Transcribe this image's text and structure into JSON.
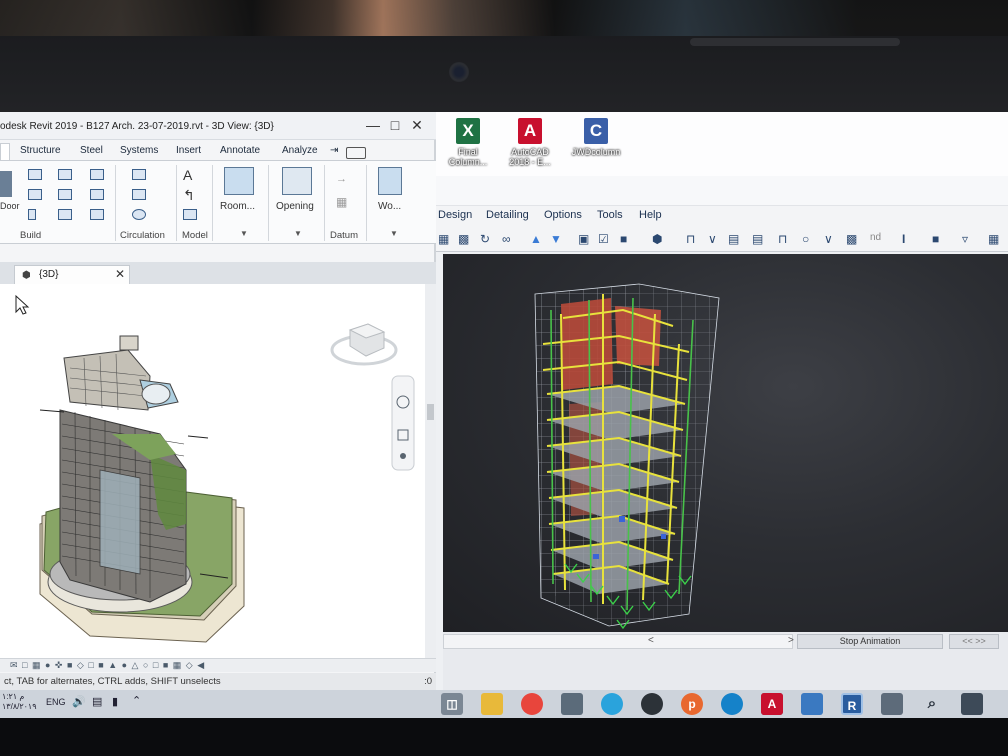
{
  "revit": {
    "title": "odesk Revit 2019 - B127 Arch. 23-07-2019.rvt - 3D View: {3D}",
    "window_controls": {
      "minimize": "—",
      "maximize": "□",
      "close": "✕"
    },
    "tabs": [
      "Structure",
      "Steel",
      "Systems",
      "Insert",
      "Annotate",
      "Analyze",
      "⇥"
    ],
    "ribbon": {
      "door_label": "Door",
      "groups": [
        "Build",
        "Circulation",
        "Model",
        "Datum"
      ],
      "big_buttons": [
        "Room...",
        "Opening",
        "Wo..."
      ]
    },
    "view_tab": {
      "label": "{3D}",
      "close": "✕"
    },
    "statusbar": {
      "hint": "ct, TAB for alternates, CTRL adds, SHIFT unselects",
      "right": ":0"
    }
  },
  "desktop_icons": [
    {
      "name": "excel-icon",
      "label": "Final Column...",
      "color": "#1f7244",
      "glyph": "X"
    },
    {
      "name": "autocad-icon",
      "label": "AutoCAD 2018 - E...",
      "color": "#c8102e",
      "glyph": "A"
    },
    {
      "name": "column-icon",
      "label": "JWDcolumn",
      "color": "#3a5fa8",
      "glyph": "C"
    }
  ],
  "etabs": {
    "menu": [
      "Design",
      "Detailing",
      "Options",
      "Tools",
      "Help"
    ],
    "toolbar_text": {
      "nd": "nd",
      "beam": "I"
    },
    "scroll": {
      "left": "<",
      "right": ">"
    },
    "stop_animation": "Stop Animation",
    "nav_arrows": "<< >>"
  },
  "taskbar": {
    "language": "ENG",
    "clock": [
      "م ١:٢١",
      "١٣/٨/٢٠١٩"
    ],
    "apps": [
      {
        "name": "task-view-icon",
        "color": "#7b8794",
        "glyph": "◫"
      },
      {
        "name": "file-explorer-icon",
        "color": "#e8b93a",
        "glyph": ""
      },
      {
        "name": "chrome-icon",
        "color": "#e8453c",
        "glyph": ""
      },
      {
        "name": "store-icon",
        "color": "#5b6b7a",
        "glyph": ""
      },
      {
        "name": "telegram-icon",
        "color": "#2aa3dc",
        "glyph": ""
      },
      {
        "name": "media-icon",
        "color": "#2c3238",
        "glyph": ""
      },
      {
        "name": "pdf-icon",
        "color": "#e8682f",
        "glyph": "p"
      },
      {
        "name": "edge-icon",
        "color": "#1582c9",
        "glyph": ""
      },
      {
        "name": "mail-icon",
        "color": "#6b7784",
        "glyph": ""
      },
      {
        "name": "autocad-taskbar-icon",
        "color": "#c8102e",
        "glyph": "A"
      },
      {
        "name": "folder-icon",
        "color": "#3a79c1",
        "glyph": ""
      },
      {
        "name": "revit-taskbar-icon",
        "color": "#2a5d9f",
        "glyph": "R"
      },
      {
        "name": "settings-icon",
        "color": "#5d6b7a",
        "glyph": ""
      },
      {
        "name": "search-icon",
        "color": "#3d4a58",
        "glyph": "⌕"
      },
      {
        "name": "windows-icon",
        "color": "#3d4a58",
        "glyph": ""
      }
    ]
  }
}
